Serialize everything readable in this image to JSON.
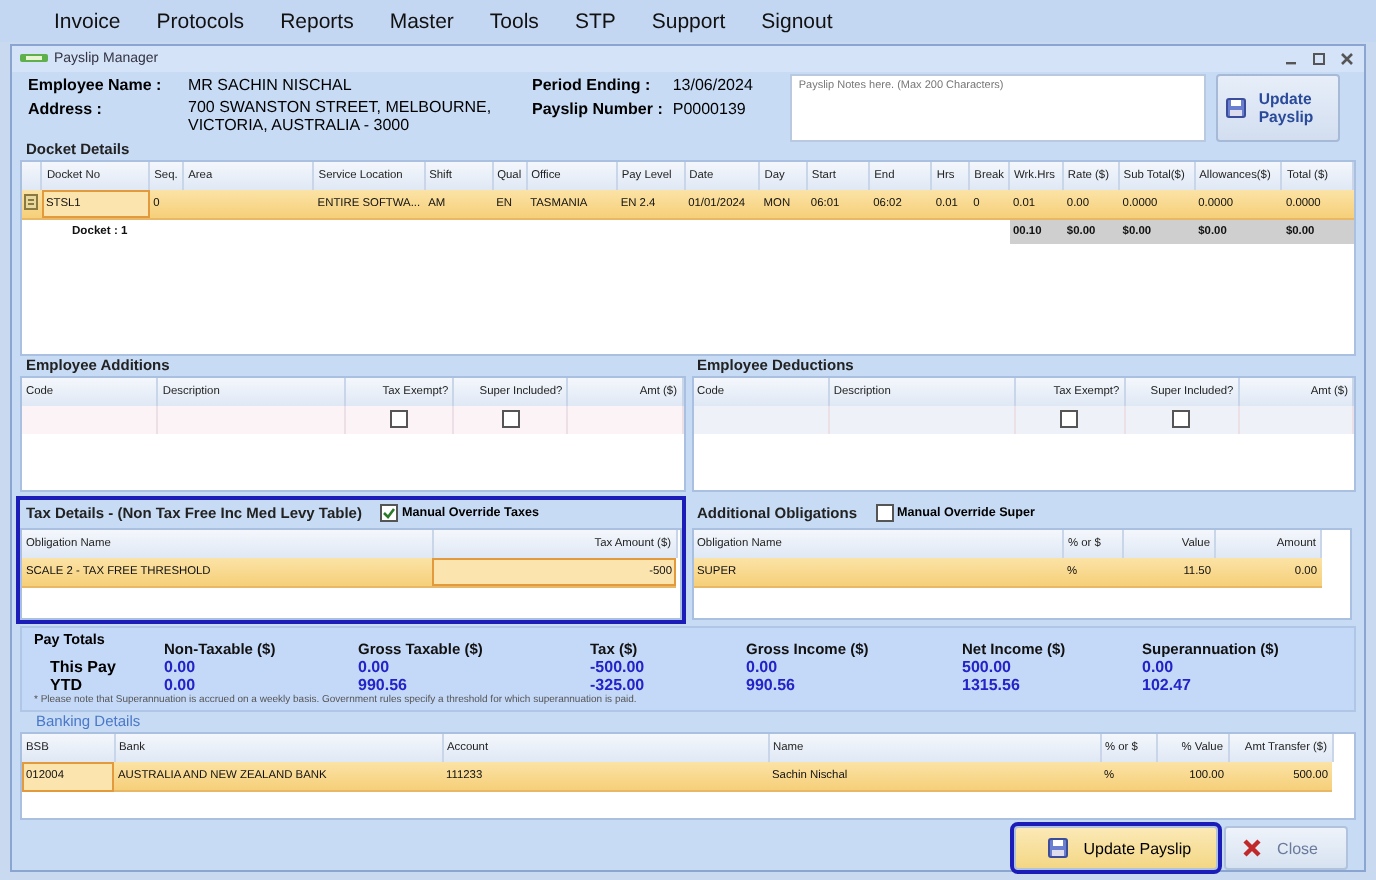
{
  "menu": [
    "Invoice",
    "Protocols",
    "Reports",
    "Master",
    "Tools",
    "STP",
    "Support",
    "Signout"
  ],
  "window": {
    "title": "Payslip Manager"
  },
  "employee": {
    "name_label": "Employee Name :",
    "name": "MR SACHIN NISCHAL",
    "address_label": "Address :",
    "address": [
      "700 SWANSTON STREET, MELBOURNE,",
      "VICTORIA, AUSTRALIA - 3000"
    ],
    "period_label": "Period Ending :",
    "period": "13/06/2024",
    "number_label": "Payslip Number :",
    "number": "P0000139"
  },
  "notes": {
    "placeholder": "Payslip Notes here. (Max 200 Characters)"
  },
  "top_button": {
    "label": "Update Payslip"
  },
  "docket": {
    "title": "Docket Details",
    "columns": [
      "Docket No",
      "Seq.",
      "Area",
      "Service Location",
      "Shift",
      "Qual",
      "Office",
      "Pay Level",
      "Date",
      "Day",
      "Start",
      "End",
      "Hrs",
      "Break",
      "Wrk.Hrs",
      "Rate ($)",
      "Sub Total($)",
      "Allowances($)",
      "Total ($)"
    ],
    "rows": [
      {
        "selected": true,
        "cells": [
          "STSL1",
          "0",
          "",
          "ENTIRE SOFTWA...",
          "AM",
          "EN",
          "TASMANIA",
          "EN 2.4",
          "01/01/2024",
          "MON",
          "06:01",
          "06:02",
          "0.01",
          "0",
          "0.01",
          "0.00",
          "0.0000",
          "0.0000",
          "0.0000"
        ]
      }
    ],
    "footer": {
      "label": "Docket : 1",
      "totals": [
        "00.10",
        "$0.00",
        "$0.00",
        "$0.00",
        "$0.00"
      ]
    }
  },
  "additions": {
    "title": "Employee Additions",
    "columns": [
      "Code",
      "Description",
      "Tax Exempt?",
      "Super Included?",
      "Amt ($)"
    ],
    "rows": [
      {
        "code": "",
        "description": "",
        "tax_exempt": false,
        "super_included": false,
        "amount": ""
      }
    ]
  },
  "deductions": {
    "title": "Employee Deductions",
    "columns": [
      "Code",
      "Description",
      "Tax Exempt?",
      "Super Included?",
      "Amt ($)"
    ],
    "rows": [
      {
        "code": "",
        "description": "",
        "tax_exempt": false,
        "super_included": false,
        "amount": ""
      }
    ]
  },
  "tax": {
    "title": "Tax Details - (Non Tax Free Inc Med Levy Table)",
    "highlighted": true,
    "override": {
      "label": "Manual Override Taxes",
      "checked": true
    },
    "columns": [
      "Obligation Name",
      "Tax Amount ($)"
    ],
    "rows": [
      {
        "selected": true,
        "cells": [
          "SCALE 2 - TAX FREE THRESHOLD",
          "-500"
        ]
      }
    ]
  },
  "obligations": {
    "title": "Additional Obligations",
    "override": {
      "label": "Manual Override Super",
      "checked": false
    },
    "columns": [
      "Obligation Name",
      "% or $",
      "Value",
      "Amount"
    ],
    "rows": [
      {
        "selected": true,
        "cells": [
          "SUPER",
          "%",
          "11.50",
          "0.00"
        ]
      }
    ]
  },
  "pay_totals": {
    "title": "Pay Totals",
    "columns": [
      "Non-Taxable ($)",
      "Gross Taxable ($)",
      "Tax ($)",
      "Gross Income ($)",
      "Net Income ($)",
      "Superannuation ($)"
    ],
    "rows": [
      {
        "label": "This Pay",
        "values": [
          "0.00",
          "0.00",
          "-500.00",
          "0.00",
          "500.00",
          "0.00"
        ]
      },
      {
        "label": "YTD",
        "values": [
          "0.00",
          "990.56",
          "-325.00",
          "990.56",
          "1315.56",
          "102.47"
        ]
      }
    ],
    "note": "* Please note that Superannuation is accrued on a weekly basis. Government rules specify a threshold for which superannuation is paid."
  },
  "banking": {
    "title": "Banking Details",
    "columns": [
      "BSB",
      "Bank",
      "Account",
      "Name",
      "% or $",
      "% Value",
      "Amt Transfer ($)"
    ],
    "rows": [
      {
        "selected": true,
        "cells": [
          "012004",
          "AUSTRALIA AND NEW ZEALAND BANK",
          "111233",
          "Sachin Nischal",
          "%",
          "100.00",
          "500.00"
        ]
      }
    ]
  },
  "buttons": [
    {
      "kind": "save",
      "label": "Update Payslip",
      "highlighted": true
    },
    {
      "kind": "close",
      "label": "Close",
      "highlighted": false
    }
  ]
}
